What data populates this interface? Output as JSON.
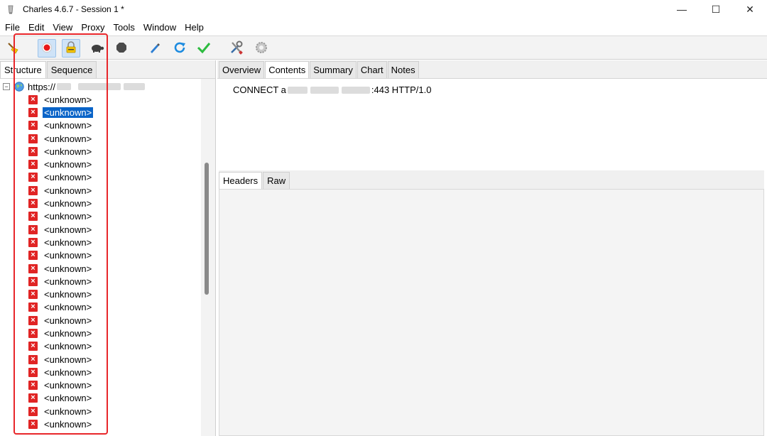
{
  "window": {
    "title": "Charles 4.6.7 - Session 1 *",
    "controls": {
      "minimize": "—",
      "maximize": "☐",
      "close": "✕"
    }
  },
  "menu": [
    "File",
    "Edit",
    "View",
    "Proxy",
    "Tools",
    "Window",
    "Help"
  ],
  "toolbar": {
    "icons": [
      "broom-icon",
      "record-icon",
      "ssl-proxying-icon",
      "throttle-icon",
      "breakpoints-icon",
      "compose-icon",
      "repeat-icon",
      "validate-icon",
      "tools-icon",
      "settings-icon"
    ]
  },
  "left_panel": {
    "tabs": [
      "Structure",
      "Sequence"
    ],
    "selected_tab": "Structure",
    "tree": {
      "root_label": "https://",
      "expander": "−",
      "items": [
        "<unknown>",
        "<unknown>",
        "<unknown>",
        "<unknown>",
        "<unknown>",
        "<unknown>",
        "<unknown>",
        "<unknown>",
        "<unknown>",
        "<unknown>",
        "<unknown>",
        "<unknown>",
        "<unknown>",
        "<unknown>",
        "<unknown>",
        "<unknown>",
        "<unknown>",
        "<unknown>",
        "<unknown>",
        "<unknown>",
        "<unknown>",
        "<unknown>",
        "<unknown>",
        "<unknown>",
        "<unknown>",
        "<unknown>"
      ],
      "selected_index": 1
    }
  },
  "right_panel": {
    "tabs": [
      "Overview",
      "Contents",
      "Summary",
      "Chart",
      "Notes"
    ],
    "selected_tab": "Contents",
    "request_line": {
      "prefix": "CONNECT a",
      "suffix": ":443 HTTP/1.0"
    },
    "sub_tabs": [
      "Headers",
      "Raw"
    ],
    "selected_sub_tab": "Headers"
  },
  "colors": {
    "selection": "#0a64c8",
    "error": "#e02424",
    "highlight": "#e8262a"
  }
}
